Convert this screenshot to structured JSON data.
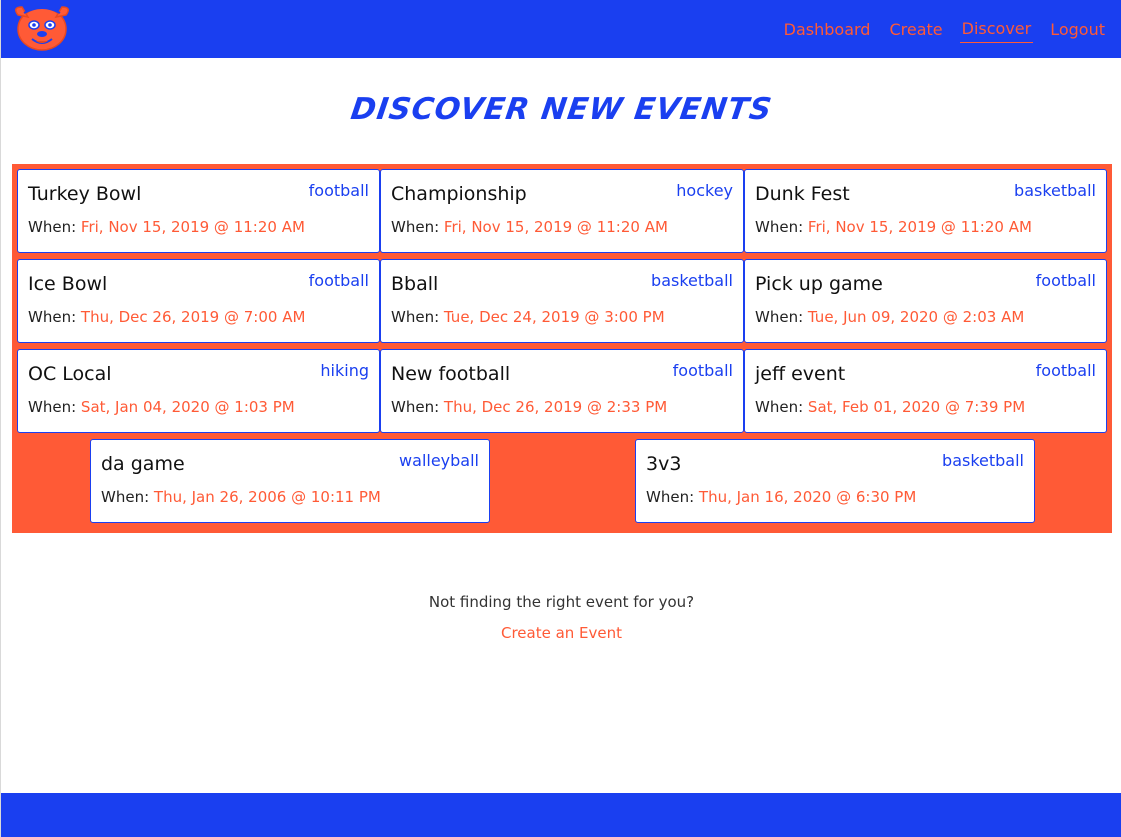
{
  "nav": {
    "logo_icon": "dog-face-logo-icon",
    "links": [
      "Dashboard",
      "Create",
      "Discover",
      "Logout"
    ],
    "active": "Discover"
  },
  "page": {
    "title": "Discover New Events"
  },
  "events": [
    {
      "title": "Turkey Bowl",
      "category": "football",
      "when_label": "When:",
      "date": "Fri, Nov 15, 2019 @ 11:20 AM"
    },
    {
      "title": "Championship",
      "category": "hockey",
      "when_label": "When:",
      "date": "Fri, Nov 15, 2019 @ 11:20 AM"
    },
    {
      "title": "Dunk Fest",
      "category": "basketball",
      "when_label": "When:",
      "date": "Fri, Nov 15, 2019 @ 11:20 AM"
    },
    {
      "title": "Ice Bowl",
      "category": "football",
      "when_label": "When:",
      "date": "Thu, Dec 26, 2019 @ 7:00 AM"
    },
    {
      "title": "Bball",
      "category": "basketball",
      "when_label": "When:",
      "date": "Tue, Dec 24, 2019 @ 3:00 PM"
    },
    {
      "title": "Pick up game",
      "category": "football",
      "when_label": "When:",
      "date": "Tue, Jun 09, 2020 @ 2:03 AM"
    },
    {
      "title": "OC Local",
      "category": "hiking",
      "when_label": "When:",
      "date": "Sat, Jan 04, 2020 @ 1:03 PM"
    },
    {
      "title": "New football",
      "category": "football",
      "when_label": "When:",
      "date": "Thu, Dec 26, 2019 @ 2:33 PM"
    },
    {
      "title": "jeff event",
      "category": "football",
      "when_label": "When:",
      "date": "Sat, Feb 01, 2020 @ 7:39 PM"
    },
    {
      "title": "da game",
      "category": "walleyball",
      "when_label": "When:",
      "date": "Thu, Jan 26, 2006 @ 10:11 PM"
    },
    {
      "title": "3v3",
      "category": "basketball",
      "when_label": "When:",
      "date": "Thu, Jan 16, 2020 @ 6:30 PM"
    }
  ],
  "footer": {
    "prompt": "Not finding the right event for you?",
    "create_link": "Create an Event"
  },
  "colors": {
    "primary_blue": "#1a3ff0",
    "accent_orange": "#ff5a36"
  }
}
